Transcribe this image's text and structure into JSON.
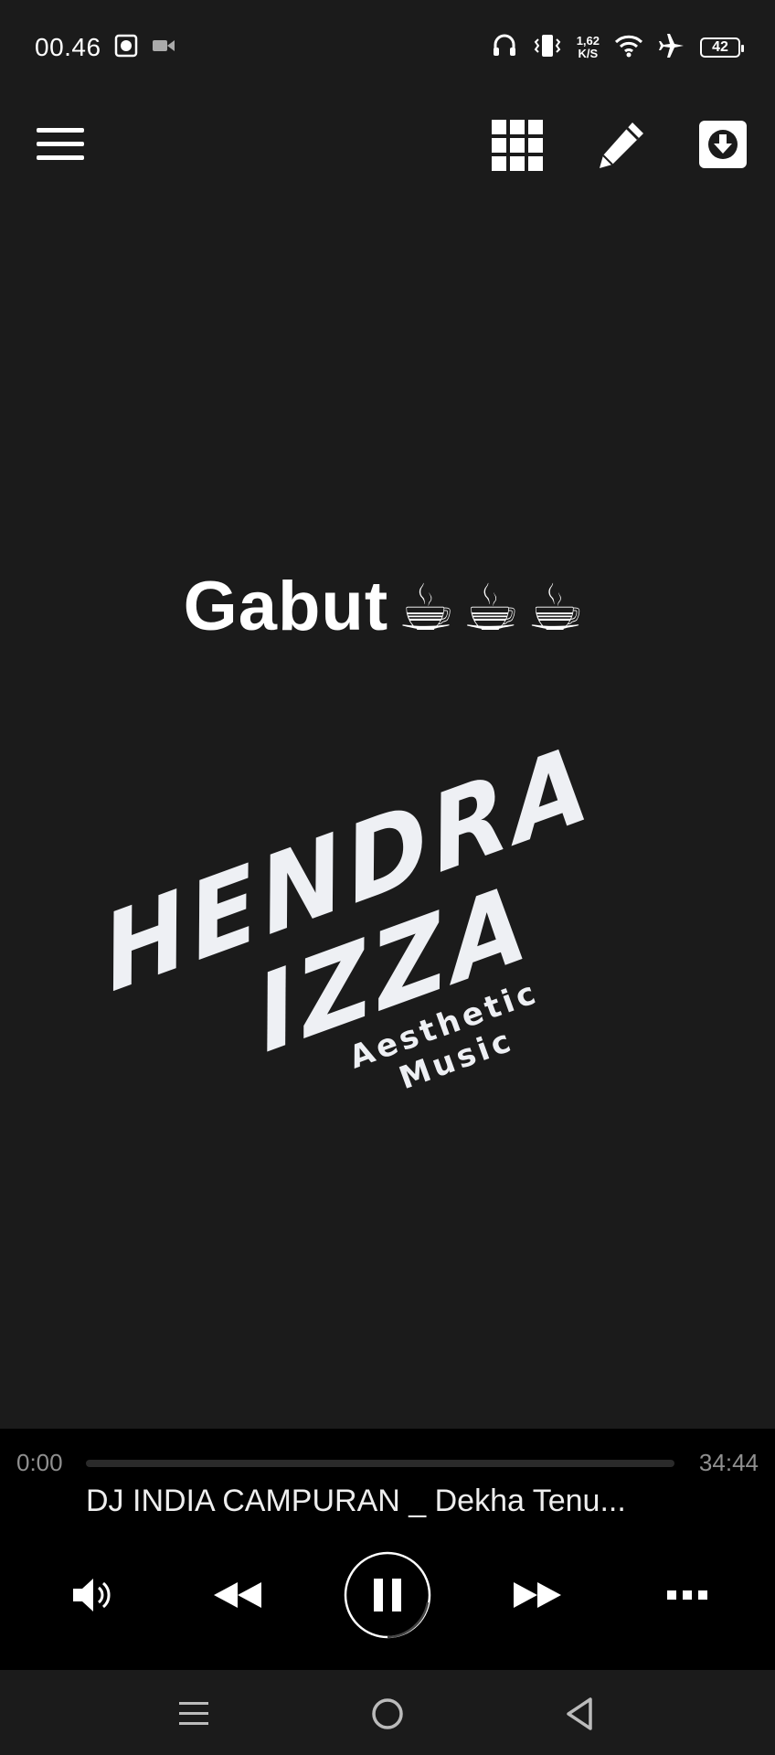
{
  "status_bar": {
    "time": "00.46",
    "net_speed_value": "1,62",
    "net_speed_unit": "K/S",
    "battery": "42"
  },
  "toolbar": {
    "menu_icon": "hamburger-menu-icon",
    "grid_icon": "grid-icon",
    "edit_icon": "pencil-icon",
    "download_icon": "download-icon"
  },
  "content": {
    "title": "Gabut",
    "title_emoji": "☕☕☕",
    "logo_line1": "HENDRA",
    "logo_line2": "IZZA",
    "logo_line3": "Aesthetic Music"
  },
  "player": {
    "current_time": "0:00",
    "total_time": "34:44",
    "progress": 0.0,
    "track_title": "DJ INDIA CAMPURAN _ Dekha Tenu...",
    "colors": {
      "background": "#000000",
      "progress_track": "#2a2a2a"
    }
  },
  "nav": {
    "menu_icon": "recents-icon",
    "home_icon": "home-icon",
    "back_icon": "back-icon"
  },
  "colors": {
    "app_background": "#1b1b1b",
    "text": "#ffffff"
  }
}
